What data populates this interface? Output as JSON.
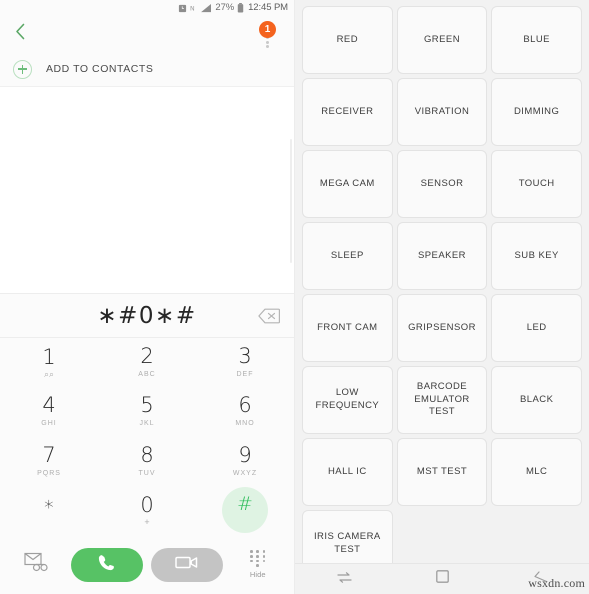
{
  "status_bar": {
    "icons": [
      "alarm-icon",
      "nfc-icon",
      "signal-icon"
    ],
    "battery_percent": "27%",
    "clock": "12:45 PM"
  },
  "app_bar": {
    "back_icon": "chevron-left-icon",
    "overflow_icon": "more-options-icon",
    "badge_count": "1"
  },
  "add_contacts": {
    "icon": "plus-circle-icon",
    "label": "ADD TO CONTACTS"
  },
  "dialer": {
    "number": "∗#0∗#",
    "backspace_icon": "backspace-icon",
    "keys": [
      {
        "digit": "1",
        "sub": "⌕⌕",
        "sub_is_glyph": true,
        "pressed": false
      },
      {
        "digit": "2",
        "sub": "ABC",
        "sub_is_glyph": false,
        "pressed": false
      },
      {
        "digit": "3",
        "sub": "DEF",
        "sub_is_glyph": false,
        "pressed": false
      },
      {
        "digit": "4",
        "sub": "GHI",
        "sub_is_glyph": false,
        "pressed": false
      },
      {
        "digit": "5",
        "sub": "JKL",
        "sub_is_glyph": false,
        "pressed": false
      },
      {
        "digit": "6",
        "sub": "MNO",
        "sub_is_glyph": false,
        "pressed": false
      },
      {
        "digit": "7",
        "sub": "PQRS",
        "sub_is_glyph": false,
        "pressed": false
      },
      {
        "digit": "8",
        "sub": "TUV",
        "sub_is_glyph": false,
        "pressed": false
      },
      {
        "digit": "9",
        "sub": "WXYZ",
        "sub_is_glyph": false,
        "pressed": false
      },
      {
        "digit": "∗",
        "sub": "",
        "sub_is_glyph": false,
        "pressed": false
      },
      {
        "digit": "0",
        "sub": "+",
        "sub_is_glyph": true,
        "pressed": false
      },
      {
        "digit": "#",
        "sub": "",
        "sub_is_glyph": false,
        "pressed": true
      }
    ]
  },
  "action_bar": {
    "voicemail_icon": "voicemail-icon",
    "call_icon": "phone-handset-icon",
    "video_call_icon": "video-camera-icon",
    "hide_icon": "keypad-dots-icon",
    "hide_label": "Hide"
  },
  "test_menu": {
    "items": [
      "RED",
      "GREEN",
      "BLUE",
      "RECEIVER",
      "VIBRATION",
      "DIMMING",
      "MEGA CAM",
      "SENSOR",
      "TOUCH",
      "SLEEP",
      "SPEAKER",
      "SUB KEY",
      "FRONT CAM",
      "GRIPSENSOR",
      "LED",
      "LOW FREQUENCY",
      "BARCODE\nEMULATOR TEST",
      "BLACK",
      "HALL IC",
      "MST TEST",
      "MLC",
      "IRIS CAMERA TEST"
    ]
  },
  "nav_bar": {
    "recents_icon": "recents-icon",
    "home_icon": "home-square-icon",
    "back_icon": "back-arrow-icon"
  },
  "watermark": "wsxdn.com",
  "colors": {
    "accent_green": "#57c265",
    "badge_orange": "#f4631e",
    "pressed_key_bg": "#dff3e3",
    "panel_bg": "#f2f2f2",
    "cell_bg": "#fafafa"
  }
}
